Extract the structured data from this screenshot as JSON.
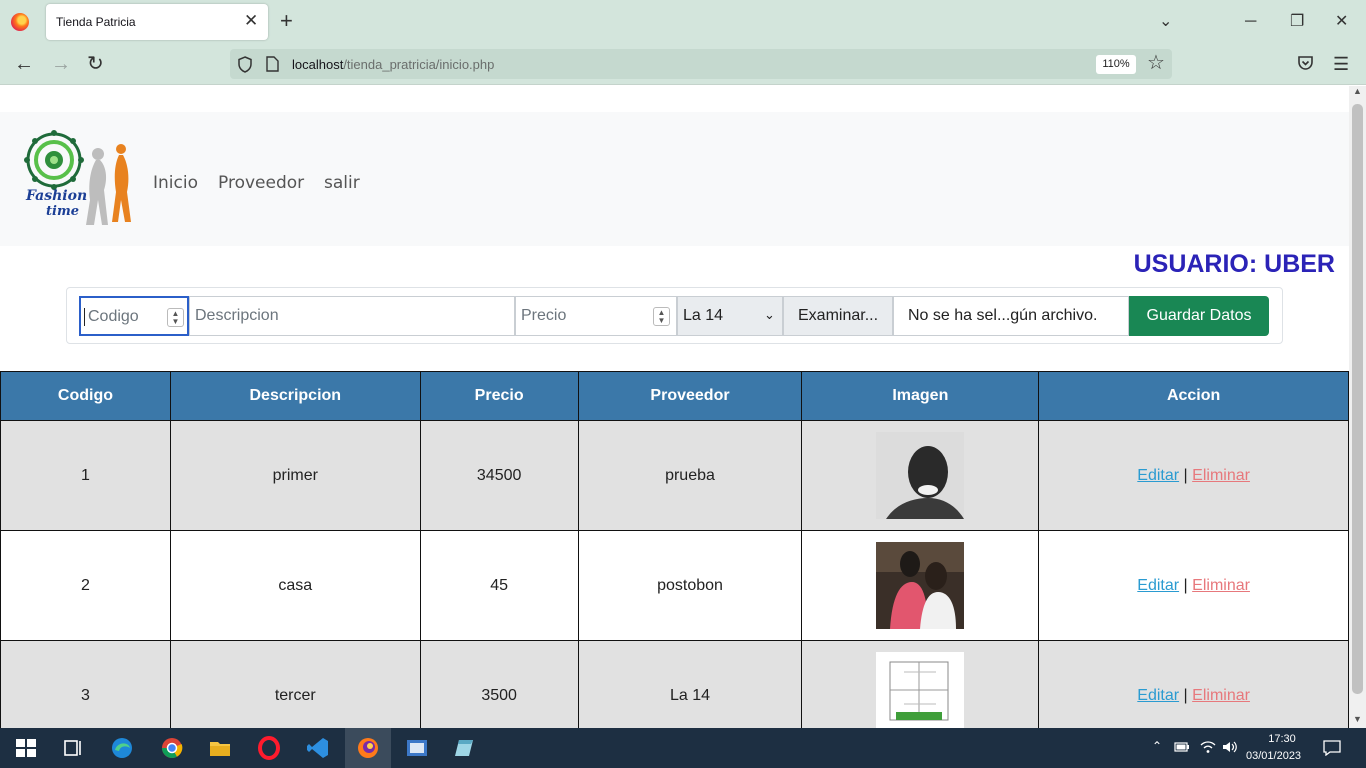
{
  "browser": {
    "tab_title": "Tienda Patricia",
    "url_host": "localhost",
    "url_path": "/tienda_pratricia/inicio.php",
    "zoom": "110%"
  },
  "header": {
    "logo_text_1": "Fashion",
    "logo_text_2": "time",
    "nav": [
      "Inicio",
      "Proveedor",
      "salir"
    ]
  },
  "user_label": "USUARIO: UBER",
  "form": {
    "codigo_placeholder": "Codigo",
    "descripcion_placeholder": "Descripcion",
    "precio_placeholder": "Precio",
    "proveedor_selected": "La 14",
    "file_button": "Examinar...",
    "file_status": "No se ha sel...gún archivo.",
    "submit": "Guardar Datos"
  },
  "table": {
    "headers": [
      "Codigo",
      "Descripcion",
      "Precio",
      "Proveedor",
      "Imagen",
      "Accion"
    ],
    "rows": [
      {
        "codigo": "1",
        "descripcion": "primer",
        "precio": "34500",
        "proveedor": "prueba",
        "edit": "Editar",
        "sep": "|",
        "delete": "Eliminar"
      },
      {
        "codigo": "2",
        "descripcion": "casa",
        "precio": "45",
        "proveedor": "postobon",
        "edit": "Editar",
        "sep": "|",
        "delete": "Eliminar"
      },
      {
        "codigo": "3",
        "descripcion": "tercer",
        "precio": "3500",
        "proveedor": "La 14",
        "edit": "Editar",
        "sep": "|",
        "delete": "Eliminar"
      }
    ]
  },
  "taskbar": {
    "time": "17:30",
    "date": "03/01/2023"
  },
  "colors": {
    "accent_green": "#198754",
    "table_header": "#3b78a9",
    "user_label": "#2b23b7"
  }
}
